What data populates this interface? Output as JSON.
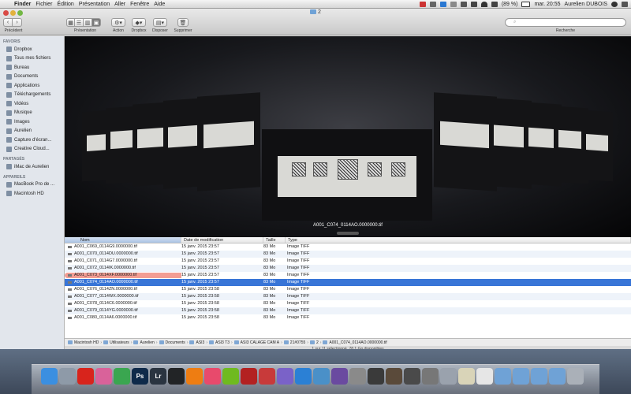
{
  "menubar": {
    "app": "Finder",
    "menus": [
      "Fichier",
      "Édition",
      "Présentation",
      "Aller",
      "Fenêtre",
      "Aide"
    ],
    "battery": "(89 %)",
    "clock": "mar. 20:55",
    "user": "Aurelien DUBOIS"
  },
  "window": {
    "title": "2",
    "toolbar": {
      "back_label": "Précédent",
      "view_label": "Présentation",
      "action_label": "Action",
      "dropbox_label": "Dropbox",
      "arrange_label": "Disposer",
      "delete_label": "Supprimer",
      "search_label": "Recherche"
    }
  },
  "sidebar": {
    "favorites_heading": "FAVORIS",
    "favorites": [
      {
        "label": "Dropbox",
        "icon": "dropbox-icon"
      },
      {
        "label": "Tous mes fichiers",
        "icon": "all-files-icon"
      },
      {
        "label": "Bureau",
        "icon": "desktop-icon"
      },
      {
        "label": "Documents",
        "icon": "documents-icon"
      },
      {
        "label": "Applications",
        "icon": "applications-icon"
      },
      {
        "label": "Téléchargements",
        "icon": "downloads-icon"
      },
      {
        "label": "Vidéos",
        "icon": "movies-icon"
      },
      {
        "label": "Musique",
        "icon": "music-icon"
      },
      {
        "label": "Images",
        "icon": "pictures-icon"
      },
      {
        "label": "Aurelien",
        "icon": "home-icon"
      },
      {
        "label": "Capture d'écran...",
        "icon": "folder-icon"
      },
      {
        "label": "Creative Cloud...",
        "icon": "creative-cloud-icon"
      }
    ],
    "shared_heading": "PARTAGÉS",
    "shared": [
      {
        "label": "iMac de Aurelien",
        "icon": "imac-icon"
      }
    ],
    "devices_heading": "APPAREILS",
    "devices": [
      {
        "label": "MacBook Pro de ...",
        "icon": "laptop-icon"
      },
      {
        "label": "Macintosh HD",
        "icon": "hard-drive-icon"
      }
    ]
  },
  "coverflow": {
    "caption": "A001_C074_0114AO.0000000.tif"
  },
  "list": {
    "columns": [
      "Nom",
      "Date de modification",
      "Taille",
      "Type"
    ],
    "rows": [
      {
        "name": "A001_C069_0114G9.0000000.tif",
        "date": "15 janv. 2015 23:57",
        "size": "83 Mo",
        "type": "Image TIFF"
      },
      {
        "name": "A001_C070_0114DU.0000000.tif",
        "date": "15 janv. 2015 23:57",
        "size": "83 Mo",
        "type": "Image TIFF"
      },
      {
        "name": "A001_C071_0114G7.0000000.tif",
        "date": "15 janv. 2015 23:57",
        "size": "83 Mo",
        "type": "Image TIFF"
      },
      {
        "name": "A001_C072_0114IK.0000000.tif",
        "date": "15 janv. 2015 23:57",
        "size": "83 Mo",
        "type": "Image TIFF"
      },
      {
        "name": "A001_C073_0114XF.0000000.tif",
        "date": "15 janv. 2015 23:57",
        "size": "83 Mo",
        "type": "Image TIFF"
      },
      {
        "name": "A001_C074_0114AO.0000000.tif",
        "date": "15 janv. 2015 23:57",
        "size": "83 Mo",
        "type": "Image TIFF"
      },
      {
        "name": "A001_C076_0114ZN.0000000.tif",
        "date": "15 janv. 2015 23:58",
        "size": "83 Mo",
        "type": "Image TIFF"
      },
      {
        "name": "A001_C077_0114WX.0000000.tif",
        "date": "15 janv. 2015 23:58",
        "size": "83 Mo",
        "type": "Image TIFF"
      },
      {
        "name": "A001_C078_0114C6.0000000.tif",
        "date": "15 janv. 2015 23:58",
        "size": "83 Mo",
        "type": "Image TIFF"
      },
      {
        "name": "A001_C079_0114YG.0000000.tif",
        "date": "15 janv. 2015 23:58",
        "size": "83 Mo",
        "type": "Image TIFF"
      },
      {
        "name": "A001_C080_0114A6.0000000.tif",
        "date": "15 janv. 2015 23:58",
        "size": "83 Mo",
        "type": "Image TIFF"
      }
    ],
    "highlighted_row": 4,
    "selected_row": 5
  },
  "pathbar": [
    "Macintosh HD",
    "Utilisateurs",
    "Aurelien",
    "Documents",
    "ASI3",
    "ASI3 T3",
    "ASI3 CALAGE CAM A",
    "21#0755",
    "2",
    "A001_C074_0114AO.0000000.tif"
  ],
  "status": "1 sur 11 sélectionné, 78,1 Go disponibles",
  "dock": [
    {
      "name": "finder-icon",
      "color": "#3b8fe0",
      "glyph": ""
    },
    {
      "name": "launchpad-icon",
      "color": "#8e9aa8",
      "glyph": ""
    },
    {
      "name": "app-red-icon",
      "color": "#d8241c",
      "glyph": ""
    },
    {
      "name": "photos-icon",
      "color": "#d9629a",
      "glyph": ""
    },
    {
      "name": "chrome-icon",
      "color": "#3aa650",
      "glyph": ""
    },
    {
      "name": "photoshop-icon",
      "color": "#0f2a4a",
      "glyph": "Ps"
    },
    {
      "name": "lightroom-icon",
      "color": "#2a3440",
      "glyph": "Lr"
    },
    {
      "name": "video-app-icon",
      "color": "#222426",
      "glyph": ""
    },
    {
      "name": "vlc-icon",
      "color": "#ee7d12",
      "glyph": ""
    },
    {
      "name": "itunes-icon",
      "color": "#e84a6c",
      "glyph": ""
    },
    {
      "name": "spotify-icon",
      "color": "#6fba1f",
      "glyph": ""
    },
    {
      "name": "media-red-icon",
      "color": "#b32121",
      "glyph": ""
    },
    {
      "name": "media-red-2-icon",
      "color": "#c83a3a",
      "glyph": ""
    },
    {
      "name": "pinwheel-icon",
      "color": "#7a62c8",
      "glyph": ""
    },
    {
      "name": "app-blue-icon",
      "color": "#2b80d5",
      "glyph": ""
    },
    {
      "name": "app-wave-icon",
      "color": "#4a90c8",
      "glyph": ""
    },
    {
      "name": "app-purple-icon",
      "color": "#6a4aa0",
      "glyph": ""
    },
    {
      "name": "app-gray-icon",
      "color": "#8a8a8a",
      "glyph": ""
    },
    {
      "name": "film-icon",
      "color": "#3a3a3a",
      "glyph": ""
    },
    {
      "name": "photo-app-icon",
      "color": "#5a4a3a",
      "glyph": ""
    },
    {
      "name": "app-dark-icon",
      "color": "#4a4a4a",
      "glyph": ""
    },
    {
      "name": "preview-icon",
      "color": "#777777",
      "glyph": ""
    },
    {
      "name": "screenshot-icon",
      "color": "#9aa2ad",
      "glyph": ""
    },
    {
      "name": "text-file-icon",
      "color": "#d9d4b8",
      "glyph": ""
    },
    {
      "name": "document-icon",
      "color": "#e6e6e6",
      "glyph": ""
    },
    {
      "name": "downloads-folder-icon",
      "color": "#6fa2d6",
      "glyph": ""
    },
    {
      "name": "folder-icon",
      "color": "#6fa2d6",
      "glyph": ""
    },
    {
      "name": "folder-2-icon",
      "color": "#6fa2d6",
      "glyph": ""
    },
    {
      "name": "folder-3-icon",
      "color": "#6fa2d6",
      "glyph": ""
    },
    {
      "name": "trash-icon",
      "color": "#aab0b8",
      "glyph": ""
    }
  ]
}
